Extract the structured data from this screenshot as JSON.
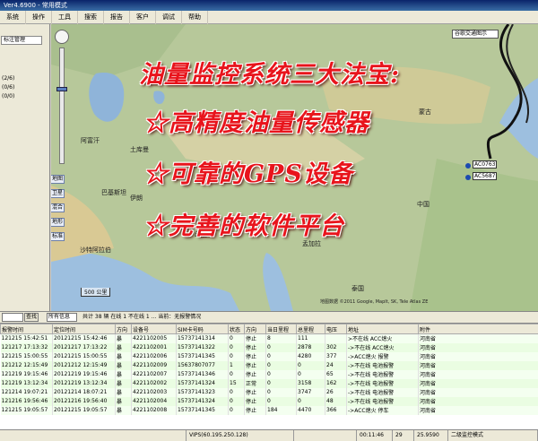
{
  "window": {
    "title": "Ver4.6900 - 常用模式"
  },
  "menu": [
    "系统",
    "操作",
    "工具",
    "搜索",
    "报告",
    "客户",
    "调试",
    "帮助"
  ],
  "left_panel": {
    "tab_label": "标注管理",
    "lines": [
      "(2/6)",
      "(0/6)",
      "(0/0)"
    ]
  },
  "map": {
    "toolbar_buttons": [
      "地图",
      "卫星",
      "混合",
      "地形",
      "标准"
    ],
    "layer_dropdown": "谷歌交通图示",
    "scale": "500 公里",
    "copyright": "地图数据 ©2011 Google, MapIt, SK, Tele Atlas ZE",
    "place_labels": [
      {
        "name": "阿富汗",
        "kind": "country"
      },
      {
        "name": "土库曼",
        "kind": "country"
      },
      {
        "name": "巴基斯坦",
        "kind": "country"
      },
      {
        "name": "伊朗",
        "kind": "country"
      },
      {
        "name": "印度",
        "kind": "country"
      },
      {
        "name": "孟加拉",
        "kind": "country"
      },
      {
        "name": "沙特阿拉伯",
        "kind": "country"
      },
      {
        "name": "中国",
        "kind": "country"
      },
      {
        "name": "蒙古",
        "kind": "country"
      },
      {
        "name": "泰国",
        "kind": "country"
      }
    ],
    "markers": [
      "AC0763",
      "AC5687"
    ],
    "overlay": {
      "headline": "油量监控系统三大法宝:",
      "items": [
        "☆高精度油量传感器",
        "☆可靠的GPS设备",
        "☆完善的软件平台"
      ]
    }
  },
  "bottom_toolbar": {
    "left_input": "",
    "search_button": "查找",
    "dropdown": "所有信息",
    "status_text": "共计 38 辆  在线 1  不在线 1  ... 当前：无报警情况"
  },
  "table": {
    "headers": [
      "报警时间",
      "定位时间",
      "方向",
      "设备号",
      "SIM卡号码",
      "状态",
      "方向",
      "当日里程",
      "总里程",
      "电压",
      "地址",
      "附件"
    ],
    "rows": [
      [
        "121215 15:42:51",
        "20121215 15:42:46",
        "暴",
        "4221102005",
        "15737141314",
        "0",
        "停止",
        "8",
        "111",
        "",
        ">不在线 ACC熄火",
        "河南省"
      ],
      [
        "121217 17:13:32",
        "20121217 17:13:22",
        "暴",
        "4221102001",
        "15737141322",
        "0",
        "停止",
        "0",
        "2878",
        "302",
        "->不在线 ACC熄火",
        "河南省"
      ],
      [
        "121215 15:00:55",
        "20121215 15:00:55",
        "暴",
        "4221102006",
        "15737141345",
        "0",
        "停止",
        "0",
        "4280",
        "377",
        "->ACC熄火 报警",
        "河南省"
      ],
      [
        "121212 12:15:49",
        "20121212 12:15:49",
        "暴",
        "4221102009",
        "15637807077",
        "1",
        "停止",
        "0",
        "0",
        "24",
        "->不在线 电池报警",
        "河南省"
      ],
      [
        "121219 19:15:46",
        "20121219 19:15:46",
        "暴",
        "4221102007",
        "15737141346",
        "0",
        "停止",
        "0",
        "0",
        "65",
        "->不在线 电池报警",
        "河南省"
      ],
      [
        "121219 13:12:34",
        "20121219 13:12:34",
        "暴",
        "4221102002",
        "15737141324",
        "15",
        "正常",
        "0",
        "3158",
        "162",
        "->不在线 电池报警",
        "河南省"
      ],
      [
        "121214 19:07:21",
        "20121214 18:07:21",
        "暴",
        "4221102003",
        "15737141323",
        "0",
        "停止",
        "0",
        "3747",
        "26",
        "->不在线 电池报警",
        "河南省"
      ],
      [
        "121216 19:56:46",
        "20121216 19:56:40",
        "暴",
        "4221102004",
        "15737141324",
        "0",
        "停止",
        "0",
        "0",
        "48",
        "->不在线 电池报警",
        "河南省"
      ],
      [
        "121215 19:05:57",
        "20121215 19:05:57",
        "暴",
        "4221102008",
        "15737141345",
        "0",
        "停止",
        "184",
        "4470",
        "366",
        "->ACC熄火 停车",
        "河南省"
      ]
    ]
  },
  "status_bar": {
    "cells": [
      "",
      "VIPS(60.195.250.128)",
      "",
      "00:11:46",
      "29",
      "25.9590",
      "二级监控模式"
    ]
  }
}
